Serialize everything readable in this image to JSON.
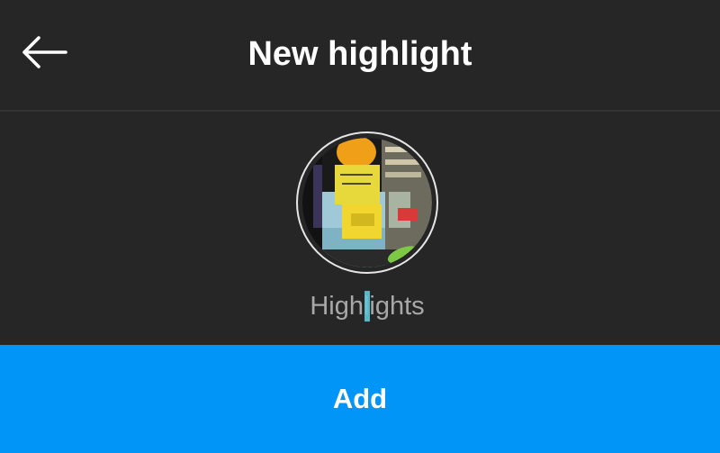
{
  "header": {
    "title": "New highlight",
    "back_icon": "arrow-left-icon"
  },
  "cover": {
    "description_icon": "highlight-cover-thumbnail"
  },
  "name_field": {
    "value": "",
    "placeholder": "Highlights"
  },
  "actions": {
    "add_label": "Add"
  },
  "colors": {
    "background": "#262626",
    "primary": "#0095f6",
    "caret": "#61c6d6",
    "placeholder": "#a8a8a8",
    "title": "#ffffff"
  }
}
